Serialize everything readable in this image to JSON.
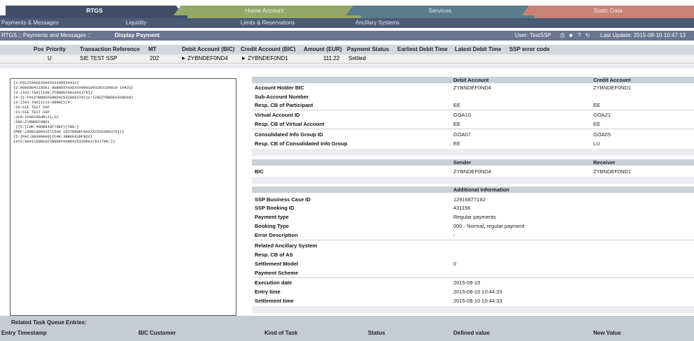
{
  "tabs": [
    {
      "label": "RTGS"
    },
    {
      "label": "Home Account"
    },
    {
      "label": "Services"
    },
    {
      "label": "Static Data"
    }
  ],
  "submenu": {
    "payments": "Payments & Messages",
    "liquidity": "Liquidity",
    "limits": "Limits & Reservations",
    "ancillary": "Ancillary Systems"
  },
  "breadcrumb": {
    "path": "RTGS :: Payments and Messages :: ",
    "current": "Display Payment",
    "user": "User: TestSSP",
    "last_update": "Last Update: 2015-08-10 10:47:13"
  },
  "columns": [
    "Pos",
    "Priority",
    "Transaction Reference",
    "MT",
    "Debit Account (BIC)",
    "Credit Account (BIC)",
    "Amount (EUR)",
    "Payment Status",
    "Earliest Debit Time",
    "Latest Debit Time",
    "SSP error code"
  ],
  "payment_row": {
    "priority": "U",
    "reference": "SIE TEST SSP",
    "mt": "202",
    "debit": "ZYBNDEF0ND4",
    "credit": "ZYBNDEF0ND1",
    "amount": "111.22",
    "status": "Settled"
  },
  "message_lines": [
    "{1:F01ZYAAXE20AXXX3106029431}",
    "{2:0096084115081 0EBNVXXXXEXXX0001893283150810 1042S}",
    "{3:{103:TGA}{108:ZYBNDEF0A1041378}}",
    "{4:{1:F01ZYBNDEF0AND42532006378}{2:I202ZYBNDEF0XND1N}",
    "{3:{103:TGA}{113:UNNN}}{4:",
    ":20:SIE TEST SSP",
    ":21:SIE TEST SSP",
    ":32A:150810EUR111,22",
    ":58A:ZYBNDEF0ND1",
    "-}{5:{CHK:49DB848F79EF}{TNG:}",
    "{MRF:1508100841571508 10ZYBNDEF0AXXX2532006378}}}",
    "{5:{PAC:00000000}{CHK:3BBEE83DF9D2}",
    "{SYS:0841150810ZYBNDEF0AND42532006378}{TNG:}}"
  ],
  "accounts": {
    "header_debit": "Debit Account",
    "header_credit": "Credit Account",
    "rows": [
      {
        "label": "Account Holder BIC",
        "debit": "ZYBNDEF0ND4",
        "credit": "ZYBNDEF0ND1"
      },
      {
        "label": "Sub-Account Number",
        "debit": "",
        "credit": ""
      },
      {
        "label": "Resp. CB of Participant",
        "debit": "EE",
        "credit": "EE"
      },
      {
        "label": "Virtual Account ID",
        "debit": "GOA10",
        "credit": "GOA21"
      },
      {
        "label": "Resp. CB of Virtual Account",
        "debit": "EE",
        "credit": "EE"
      },
      {
        "label": "Consolidated Info Group ID",
        "debit": "GOA07",
        "credit": "GOA05"
      },
      {
        "label": "Resp. CB of Consolidated Info Group",
        "debit": "EE",
        "credit": "LU"
      }
    ]
  },
  "parties": {
    "header_sender": "Sender",
    "header_receiver": "Receiver",
    "label": "BIC",
    "sender": "ZYBNDEF0ND4",
    "receiver": "ZYBNDEF0ND1"
  },
  "additional": {
    "header": "Additional Information",
    "rows": [
      {
        "label": "SSP Business Case ID",
        "value": "12916877192"
      },
      {
        "label": "SSP Booking ID",
        "value": "431156"
      },
      {
        "label": "Payment type",
        "value": "Regular payments"
      },
      {
        "label": "Booking Type",
        "value": "000 - Normal, regular payment"
      },
      {
        "label": "Error Description",
        "value": "-"
      },
      {
        "label": "Related Ancillary System",
        "value": ""
      },
      {
        "label": "Resp. CB of AS",
        "value": ""
      },
      {
        "label": "Settlement Model",
        "value": "0"
      },
      {
        "label": "Payment Scheme",
        "value": ""
      },
      {
        "label": "Execution date",
        "value": "2015-08-10"
      },
      {
        "label": "Entry time",
        "value": "2015-08-10 10:44:33"
      },
      {
        "label": "Settlement time",
        "value": "2015-08-10 10:44:33"
      }
    ]
  },
  "related": {
    "title": "Related Task Queue Entries:",
    "columns": [
      "Entry Timestamp",
      "BIC Customer",
      "Kind of Task",
      "Status",
      "Defined value",
      "New Value"
    ]
  },
  "colors": {
    "rtgs_tab": "#3f4e66",
    "home_tab": "#96a868",
    "services_tab": "#5a7c8c",
    "static_tab": "#c98276"
  },
  "icons": [
    "print-icon",
    "save-icon",
    "help-icon",
    "refresh-icon",
    "arrow-right-icon"
  ]
}
